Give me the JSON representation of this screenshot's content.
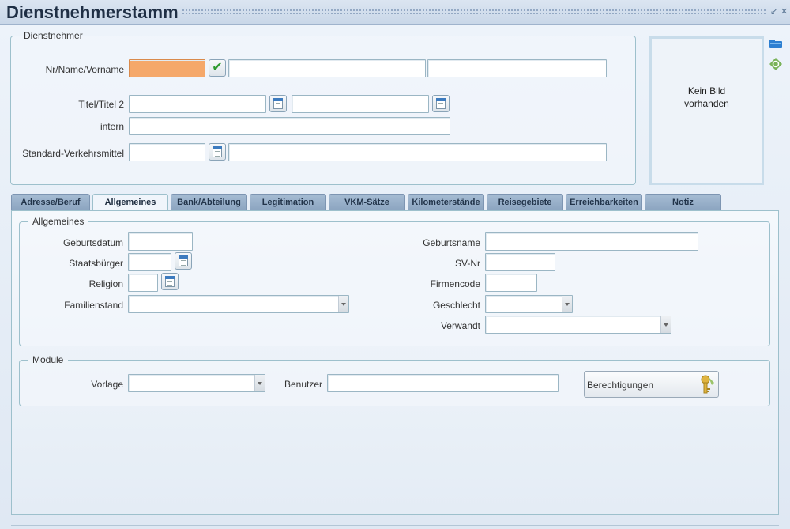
{
  "window": {
    "title": "Dienstnehmerstamm",
    "minimize_icon": "minimize-icon",
    "close_icon": "close-icon"
  },
  "dienstnehmer": {
    "legend": "Dienstnehmer",
    "labels": {
      "name": "Nr/Name/Vorname",
      "titel": "Titel/Titel 2",
      "intern": "intern",
      "verkehrsmittel": "Standard-Verkehrsmittel"
    },
    "values": {
      "nr": "",
      "name": "",
      "vorname": "",
      "titel": "",
      "titel2": "",
      "intern": "",
      "verkehrsmittel_code": "",
      "verkehrsmittel_text": ""
    },
    "photo_text_line1": "Kein Bild",
    "photo_text_line2": "vorhanden",
    "side_icons": [
      "folder-icon",
      "refresh-icon"
    ]
  },
  "tabs": [
    {
      "label": "Adresse/Beruf",
      "active": false
    },
    {
      "label": "Allgemeines",
      "active": true
    },
    {
      "label": "Bank/Abteilung",
      "active": false
    },
    {
      "label": "Legitimation",
      "active": false
    },
    {
      "label": "VKM-Sätze",
      "active": false
    },
    {
      "label": "Kilometerstände",
      "active": false
    },
    {
      "label": "Reisegebiete",
      "active": false
    },
    {
      "label": "Erreichbarkeiten",
      "active": false
    },
    {
      "label": "Notiz",
      "active": false
    }
  ],
  "allgemeines": {
    "legend": "Allgemeines",
    "left_labels": {
      "geburtsdatum": "Geburtsdatum",
      "staatsbuerger": "Staatsbürger",
      "religion": "Religion",
      "familienstand": "Familienstand"
    },
    "right_labels": {
      "geburtsname": "Geburtsname",
      "svnr": "SV-Nr",
      "firmencode": "Firmencode",
      "geschlecht": "Geschlecht",
      "verwandt": "Verwandt"
    },
    "values": {
      "geburtsdatum": "",
      "staatsbuerger": "",
      "religion": "",
      "familienstand": "",
      "geburtsname": "",
      "svnr": "",
      "firmencode": "",
      "geschlecht": "",
      "verwandt": ""
    }
  },
  "module": {
    "legend": "Module",
    "vorlage_label": "Vorlage",
    "benutzer_label": "Benutzer",
    "vorlage_value": "",
    "benutzer_value": "",
    "berechtigungen_label": "Berechtigungen",
    "berechtigungen_icon": "key-icon"
  },
  "colors": {
    "focus_field": "#f5a86a",
    "tab_inactive": "#8aa3bf",
    "border": "#9dc0cc"
  }
}
